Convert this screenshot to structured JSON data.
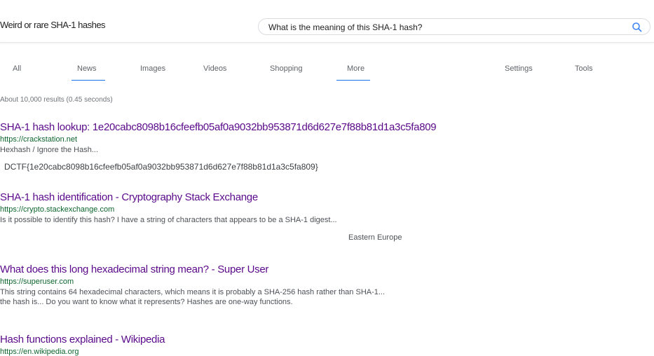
{
  "header": {
    "site_title": "Weird or rare SHA-1 hashes",
    "query": "What is the meaning of this SHA-1 hash?",
    "search_icon": "search-icon"
  },
  "tabs": [
    {
      "label": "All"
    },
    {
      "label": "News"
    },
    {
      "label": "Images"
    },
    {
      "label": "Videos"
    },
    {
      "label": "Shopping"
    },
    {
      "label": "More"
    },
    {
      "label": "Settings"
    },
    {
      "label": "Tools"
    }
  ],
  "result_stats": "About 10,000 results (0.45 seconds)",
  "results": [
    {
      "title": "SHA-1 hash lookup: 1e20cabc8098b16cfeefb05af0a9032bb953871d6d627e7f88b81d1a3c5fa809",
      "url": "https://crackstation.net",
      "snippet": "Hexhash / Ignore the Hash..."
    },
    {
      "title": "SHA-1 hash identification - Cryptography Stack Exchange",
      "url": "https://crypto.stackexchange.com",
      "snippet": "Is it possible to identify this hash? I have a string of characters that appears to be a SHA-1 digest...",
      "snippet2": "Eastern Europe"
    },
    {
      "title": "What does this long hexadecimal string mean? - Super User",
      "url": "https://superuser.com",
      "snippet": "This string contains 64 hexadecimal characters, which means it is probably a SHA-256 hash rather than SHA-1...",
      "snippet2": "the hash is... Do you want to know what it represents? Hashes are one-way functions."
    },
    {
      "title": "Hash functions explained - Wikipedia",
      "url": "https://en.wikipedia.org",
      "snippet": ""
    }
  ],
  "hash_line": "DCTF{1e20cabc8098b16cfeefb05af0a9032bb953871d6d627e7f88b81d1a3c5fa809}",
  "region_label": "Eastern Europe",
  "colors": {
    "link_visited": "#5a0a8a",
    "url_green": "#0d652d",
    "accent_blue": "#1a73e8"
  }
}
